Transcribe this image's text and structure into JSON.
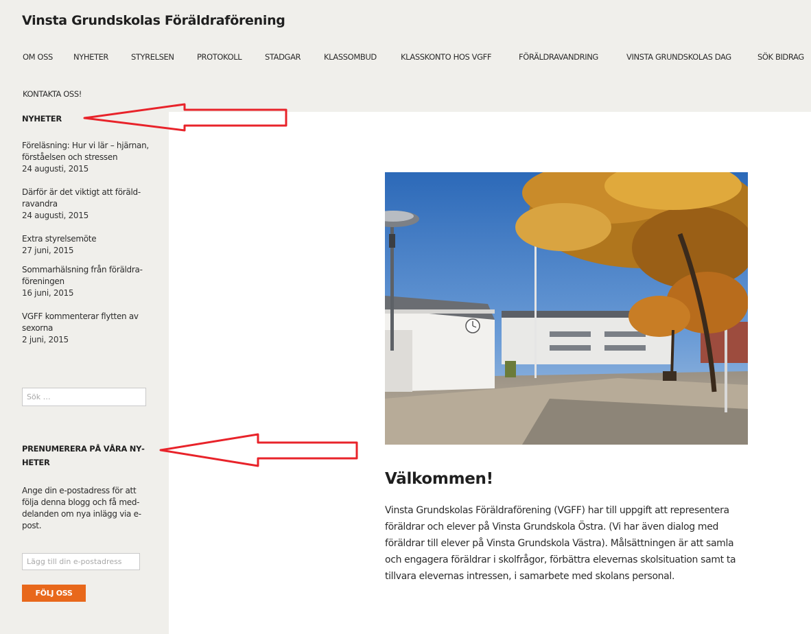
{
  "site": {
    "title": "Vinsta Grundskolas Föräldraförening"
  },
  "nav": {
    "items": [
      {
        "label": "OM OSS"
      },
      {
        "label": "NYHETER"
      },
      {
        "label": "STYRELSEN"
      },
      {
        "label": "PROTOKOLL"
      },
      {
        "label": "STADGAR"
      },
      {
        "label": "KLASSOMBUD"
      },
      {
        "label": "KLASSKONTO HOS VGFF"
      },
      {
        "label": "FÖRÄLDRAVANDRING"
      },
      {
        "label": "VINSTA GRUNDSKOLAS DAG"
      },
      {
        "label": "SÖK BIDRAG"
      },
      {
        "label": "KONTAKTA OSS!"
      }
    ]
  },
  "sidebar": {
    "news_title": "NYHETER",
    "posts": [
      {
        "title": "Föreläsning: Hur vi lär – hjär­nan, förståelsen och stressen",
        "date": "24 augusti, 2015"
      },
      {
        "title": "Därför är det viktigt att föräld­ravandra",
        "date": "24 augusti, 2015"
      },
      {
        "title": "Extra styrelsemöte",
        "date": "27 juni, 2015"
      },
      {
        "title": "Sommarhälsning från föräldra­föreningen",
        "date": "16 juni, 2015"
      },
      {
        "title": "VGFF kommenterar flytten av sexorna",
        "date": "2 juni, 2015"
      }
    ],
    "search": {
      "placeholder": "Sök …"
    },
    "subscribe": {
      "title": "PRENUMERERA PÅ VÅRA NY­HETER",
      "description": "Ange din e-postadress för att följa denna blogg och få med­delanden om nya inlägg via e-post.",
      "email_placeholder": "Lägg till din e-postadress",
      "button_label": "FÖLJ OSS"
    }
  },
  "main": {
    "welcome_title": "Välkommen!",
    "welcome_text": "Vinsta Grundskolas Föräldraförening (VGFF) har till uppgift att re­presentera föräldrar och elever på Vinsta Grundskola Östra. (Vi har även dialog med föräldrar till elever på Vinsta Grundskola Västra). Målsättningen är att samla och engagera föräldrar i skolfrågor, för­bättra elevernas skolsituation samt ta tillvara elevernas intressen, i samarbete med skolans personal."
  },
  "colors": {
    "header_bg": "#f0efeb",
    "sidebar_bg": "#f0efeb",
    "accent_button": "#e8681b",
    "annotation_arrow": "#e8232a"
  }
}
